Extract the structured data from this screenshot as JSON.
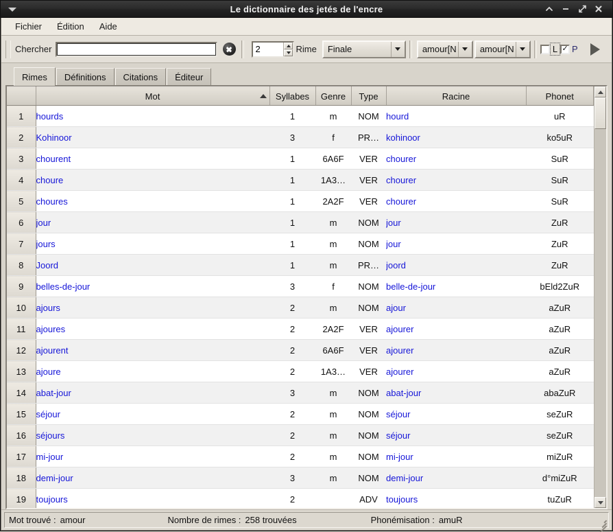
{
  "window": {
    "title": "Le dictionnaire des jetés de l'encre",
    "titlebar_buttons": [
      {
        "name": "shade-button",
        "glyph": "▲"
      },
      {
        "name": "minimize-button",
        "glyph": "—"
      },
      {
        "name": "maximize-button",
        "glyph": "⤢"
      },
      {
        "name": "close-button",
        "glyph": "✕"
      }
    ],
    "menu_icon": "window-menu-icon"
  },
  "menubar": {
    "items": [
      {
        "label": "Fichier"
      },
      {
        "label": "Édition"
      },
      {
        "label": "Aide"
      }
    ]
  },
  "toolbar": {
    "search_label": "Chercher",
    "search_value": "",
    "search_placeholder": "",
    "clear_icon": "clear-circle-icon",
    "spinner_value": "2",
    "rime_label": "Rime",
    "rime_selected": "Finale",
    "word_combo_1": "amour[N",
    "word_combo_2": "amour[N",
    "checkbox_l": {
      "label": "L",
      "checked": false
    },
    "checkbox_p": {
      "label": "P",
      "checked": true,
      "mark": "✓"
    },
    "play_icon": "play-triangle-icon"
  },
  "tabs": [
    {
      "label": "Rimes",
      "active": true
    },
    {
      "label": "Définitions",
      "active": false
    },
    {
      "label": "Citations",
      "active": false
    },
    {
      "label": "Éditeur",
      "active": false
    }
  ],
  "table": {
    "columns": [
      "",
      "Mot",
      "Syllabes",
      "Genre",
      "Type",
      "Racine",
      "Phonet"
    ],
    "sorted_column": "Mot",
    "sort_direction": "asc",
    "sort_icon": "sort-ascending-arrow-icon",
    "rows": [
      {
        "n": "1",
        "mot": "hourds",
        "syl": "1",
        "gen": "m",
        "typ": "NOM",
        "rac": "hourd",
        "pho": "uR"
      },
      {
        "n": "2",
        "mot": "Kohinoor",
        "syl": "3",
        "gen": "f",
        "typ": "PR…",
        "rac": "kohinoor",
        "pho": "ko5uR"
      },
      {
        "n": "3",
        "mot": "chourent",
        "syl": "1",
        "gen": "6A6F",
        "typ": "VER",
        "rac": "chourer",
        "pho": "SuR"
      },
      {
        "n": "4",
        "mot": "choure",
        "syl": "1",
        "gen": "1A3…",
        "typ": "VER",
        "rac": "chourer",
        "pho": "SuR"
      },
      {
        "n": "5",
        "mot": "choures",
        "syl": "1",
        "gen": "2A2F",
        "typ": "VER",
        "rac": "chourer",
        "pho": "SuR"
      },
      {
        "n": "6",
        "mot": "jour",
        "syl": "1",
        "gen": "m",
        "typ": "NOM",
        "rac": "jour",
        "pho": "ZuR"
      },
      {
        "n": "7",
        "mot": "jours",
        "syl": "1",
        "gen": "m",
        "typ": "NOM",
        "rac": "jour",
        "pho": "ZuR"
      },
      {
        "n": "8",
        "mot": "Joord",
        "syl": "1",
        "gen": "m",
        "typ": "PR…",
        "rac": "joord",
        "pho": "ZuR"
      },
      {
        "n": "9",
        "mot": "belles-de-jour",
        "syl": "3",
        "gen": "f",
        "typ": "NOM",
        "rac": "belle-de-jour",
        "pho": "bEld2ZuR"
      },
      {
        "n": "10",
        "mot": "ajours",
        "syl": "2",
        "gen": "m",
        "typ": "NOM",
        "rac": "ajour",
        "pho": "aZuR"
      },
      {
        "n": "11",
        "mot": "ajoures",
        "syl": "2",
        "gen": "2A2F",
        "typ": "VER",
        "rac": "ajourer",
        "pho": "aZuR"
      },
      {
        "n": "12",
        "mot": "ajourent",
        "syl": "2",
        "gen": "6A6F",
        "typ": "VER",
        "rac": "ajourer",
        "pho": "aZuR"
      },
      {
        "n": "13",
        "mot": "ajoure",
        "syl": "2",
        "gen": "1A3…",
        "typ": "VER",
        "rac": "ajourer",
        "pho": "aZuR"
      },
      {
        "n": "14",
        "mot": "abat-jour",
        "syl": "3",
        "gen": "m",
        "typ": "NOM",
        "rac": "abat-jour",
        "pho": "abaZuR"
      },
      {
        "n": "15",
        "mot": "séjour",
        "syl": "2",
        "gen": "m",
        "typ": "NOM",
        "rac": "séjour",
        "pho": "seZuR"
      },
      {
        "n": "16",
        "mot": "séjours",
        "syl": "2",
        "gen": "m",
        "typ": "NOM",
        "rac": "séjour",
        "pho": "seZuR"
      },
      {
        "n": "17",
        "mot": "mi-jour",
        "syl": "2",
        "gen": "m",
        "typ": "NOM",
        "rac": "mi-jour",
        "pho": "miZuR"
      },
      {
        "n": "18",
        "mot": "demi-jour",
        "syl": "3",
        "gen": "m",
        "typ": "NOM",
        "rac": "demi-jour",
        "pho": "d°miZuR"
      },
      {
        "n": "19",
        "mot": "toujours",
        "syl": "2",
        "gen": "",
        "typ": "ADV",
        "rac": "toujours",
        "pho": "tuZuR"
      }
    ]
  },
  "statusbar": {
    "found_label": "Mot trouvé :",
    "found_value": "amour",
    "rhymes_label": "Nombre de rimes :",
    "rhymes_value": "258 trouvées",
    "phon_label": "Phonémisation :",
    "phon_value": "amuR"
  },
  "colors": {
    "link": "#1515d8",
    "titlebar": "#232323",
    "panel": "#d8d4cb"
  }
}
